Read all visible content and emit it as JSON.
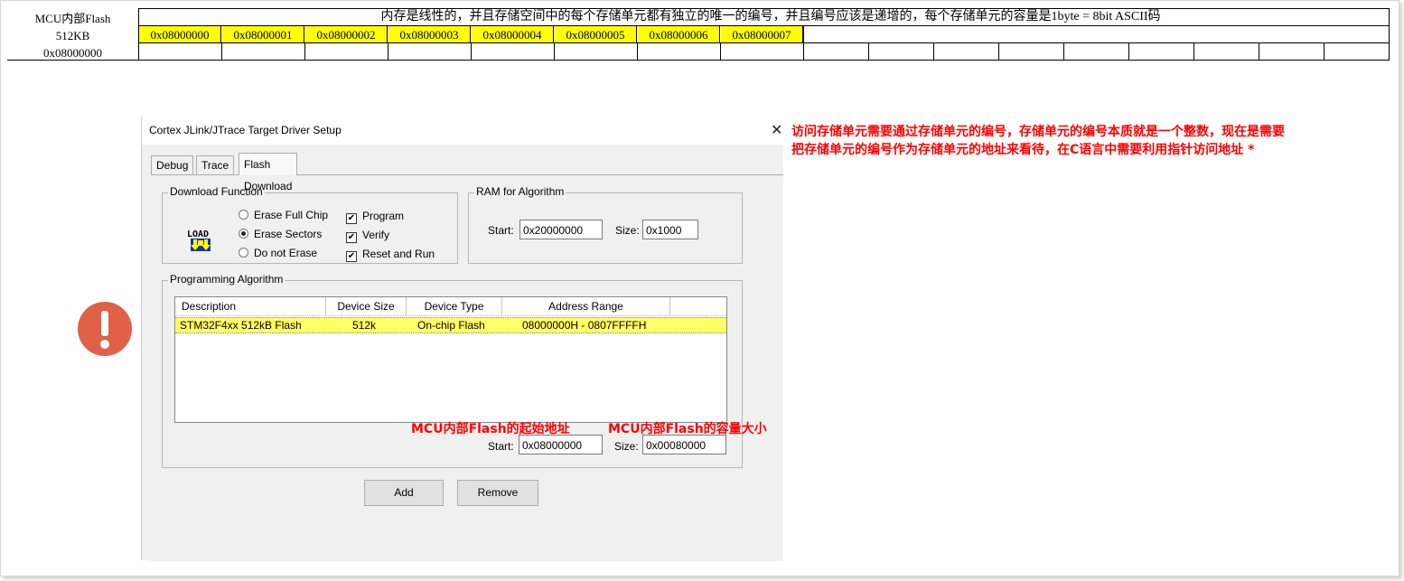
{
  "sheet": {
    "row_labels": [
      "MCU内部Flash",
      "512KB",
      "0x08000000"
    ],
    "top_text": "内存是线性的，并且存储空间中的每个存储单元都有独立的唯一的编号，并且编号应该是递增的，每个存储单元的容量是1byte = 8bit     ASCII码",
    "addresses": [
      "0x08000000",
      "0x08000001",
      "0x08000002",
      "0x08000003",
      "0x08000004",
      "0x08000005",
      "0x08000006",
      "0x08000007"
    ],
    "highlight_color": "#ffff00"
  },
  "dialog": {
    "title": "Cortex JLink/JTrace Target Driver Setup",
    "close_icon": "close-icon",
    "tabs": [
      "Debug",
      "Trace",
      "Flash Download"
    ],
    "active_tab": "Flash Download",
    "download_function": {
      "title": "Download Function",
      "icon": "load-icon",
      "icon_text": "LOAD",
      "radios": [
        {
          "label": "Erase Full Chip",
          "selected": false
        },
        {
          "label": "Erase Sectors",
          "selected": true
        },
        {
          "label": "Do not Erase",
          "selected": false
        }
      ],
      "checks": [
        {
          "label": "Program",
          "checked": true
        },
        {
          "label": "Verify",
          "checked": true
        },
        {
          "label": "Reset and Run",
          "checked": true
        }
      ]
    },
    "ram": {
      "title": "RAM for Algorithm",
      "start_label": "Start:",
      "start_value": "0x20000000",
      "size_label": "Size:",
      "size_value": "0x1000"
    },
    "programming": {
      "title": "Programming Algorithm",
      "columns": [
        "Description",
        "Device Size",
        "Device Type",
        "Address Range"
      ],
      "rows": [
        [
          "STM32F4xx 512kB Flash",
          "512k",
          "On-chip Flash",
          "08000000H - 0807FFFFH"
        ]
      ],
      "row_highlight": "#ffff66",
      "start_label": "Start:",
      "start_value": "0x08000000",
      "size_label": "Size:",
      "size_value": "0x00080000"
    },
    "buttons": {
      "add": "Add",
      "remove": "Remove"
    }
  },
  "annotations": {
    "note_line1": "访问存储单元需要通过存储单元的编号，存储单元的编号本质就是一个整数，现在是需要",
    "note_line2": "把存储单元的编号作为存储单元的地址来看待，在C语言中需要利用指针访问地址  *",
    "start_note": "MCU内部Flash的起始地址",
    "size_note": "MCU内部Flash的容量大小",
    "note_color": "#ff0000",
    "warning_icon": "exclamation-icon",
    "warning_color": "#e06048"
  }
}
